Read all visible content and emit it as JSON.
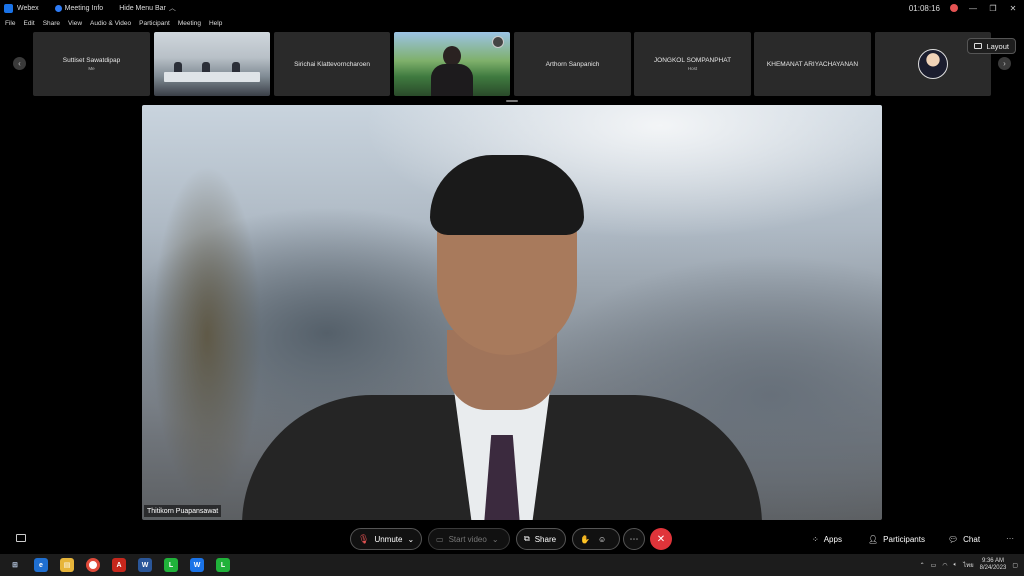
{
  "titlebar": {
    "app_name": "Webex",
    "meeting_info": "Meeting Info",
    "hide_menu_bar": "Hide Menu Bar",
    "timer": "01:08:16"
  },
  "menu": [
    "File",
    "Edit",
    "Share",
    "View",
    "Audio & Video",
    "Participant",
    "Meeting",
    "Help"
  ],
  "participants_strip": {
    "tiles": [
      {
        "name": "Suttiset Sawatdipap",
        "sub": "Me"
      },
      {
        "name": "",
        "sub": ""
      },
      {
        "name": "Sirichai Klattevorncharoen",
        "sub": ""
      },
      {
        "name": "",
        "sub": ""
      },
      {
        "name": "Arthorn Sanpanich",
        "sub": ""
      },
      {
        "name": "JONGKOL SOMPANPHAT",
        "sub": "Host"
      },
      {
        "name": "KHEMANAT ARIYACHAYANAN",
        "sub": ""
      },
      {
        "name": "",
        "sub": ""
      }
    ],
    "layout_label": "Layout"
  },
  "main_video": {
    "speaker_name": "Thitikorn Puapansawat"
  },
  "controls": {
    "unmute": "Unmute",
    "start_video": "Start video",
    "share": "Share",
    "apps": "Apps",
    "participants": "Participants",
    "chat": "Chat"
  },
  "taskbar": {
    "language": "ไทย",
    "time": "9:36 AM",
    "date": "8/24/2023"
  },
  "colors": {
    "end_meeting": "#e0343a",
    "muted_mic": "#e55353",
    "recording": "#e55353"
  }
}
